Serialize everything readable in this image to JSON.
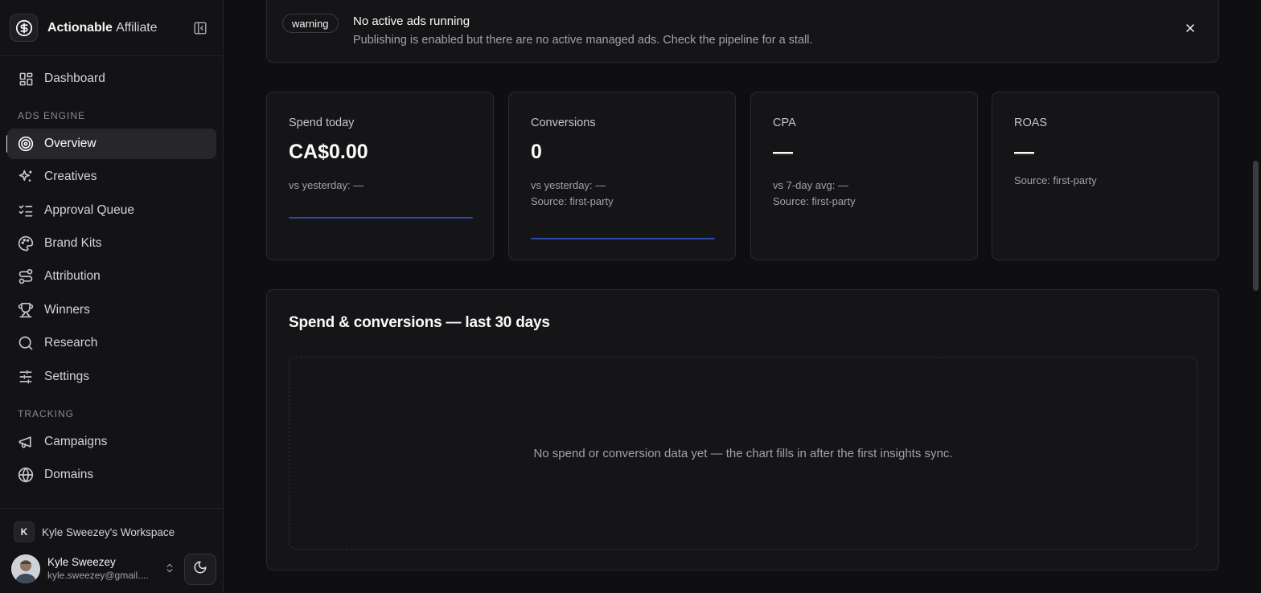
{
  "brand": {
    "name_bold": "Actionable",
    "name_light": "Affiliate"
  },
  "sidebar": {
    "dashboard": "Dashboard",
    "sections": {
      "ads_engine": "ADS ENGINE",
      "tracking": "TRACKING"
    },
    "ads_engine_items": [
      {
        "label": "Overview",
        "icon": "target-icon",
        "active": true
      },
      {
        "label": "Creatives",
        "icon": "sparkles-icon"
      },
      {
        "label": "Approval Queue",
        "icon": "list-checks-icon"
      },
      {
        "label": "Brand Kits",
        "icon": "palette-icon"
      },
      {
        "label": "Attribution",
        "icon": "route-icon"
      },
      {
        "label": "Winners",
        "icon": "trophy-icon"
      },
      {
        "label": "Research",
        "icon": "search-icon"
      },
      {
        "label": "Settings",
        "icon": "sliders-icon"
      }
    ],
    "tracking_items": [
      {
        "label": "Campaigns",
        "icon": "megaphone-icon"
      },
      {
        "label": "Domains",
        "icon": "globe-icon"
      }
    ],
    "workspace": {
      "badge": "K",
      "name": "Kyle Sweezey's Workspace"
    },
    "user": {
      "name": "Kyle Sweezey",
      "email": "kyle.sweezey@gmail...."
    }
  },
  "alert": {
    "badge": "warning",
    "title": "No active ads running",
    "description": "Publishing is enabled but there are no active managed ads. Check the pipeline for a stall."
  },
  "kpis": [
    {
      "label": "Spend today",
      "value": "CA$0.00",
      "sub1": "vs yesterday: —",
      "sub2": ""
    },
    {
      "label": "Conversions",
      "value": "0",
      "sub1": "vs yesterday: —",
      "sub2": "Source: first-party"
    },
    {
      "label": "CPA",
      "value": "—",
      "sub1": "vs 7-day avg: —",
      "sub2": "Source: first-party"
    },
    {
      "label": "ROAS",
      "value": "—",
      "sub1": "Source: first-party",
      "sub2": ""
    }
  ],
  "chart": {
    "title": "Spend & conversions — last 30 days",
    "empty_message": "No spend or conversion data yet — the chart fills in after the first insights sync."
  },
  "colors": {
    "accent_line": "#2f49a8",
    "background": "#0f0f11",
    "card": "#151517"
  }
}
